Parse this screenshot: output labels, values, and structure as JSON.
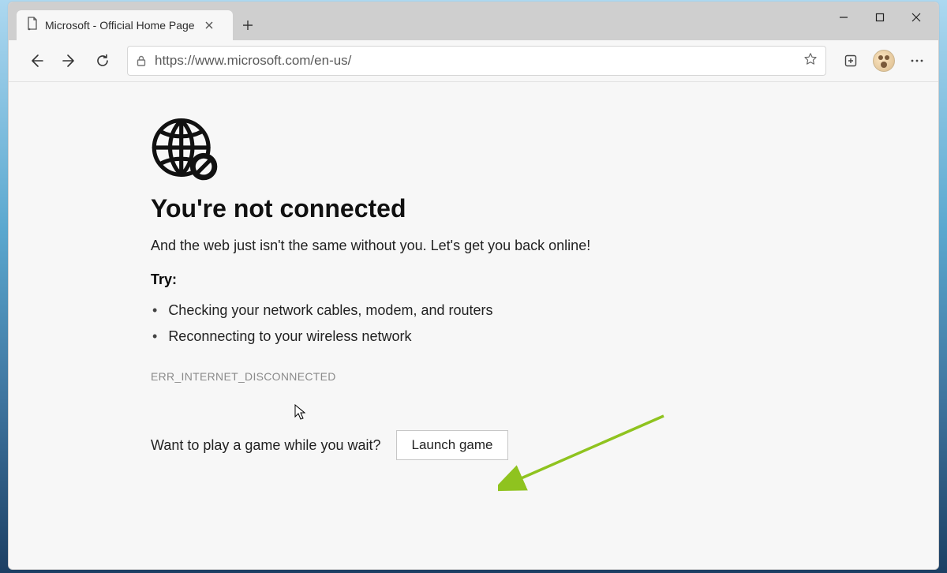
{
  "tab": {
    "title": "Microsoft - Official Home Page"
  },
  "addressbar": {
    "scheme_host_path": "https://www.microsoft.com/en-us/",
    "host": "www.microsoft.com"
  },
  "error": {
    "title": "You're not connected",
    "subtitle": "And the web just isn't the same without you. Let's get you back online!",
    "try_label": "Try:",
    "tips": [
      "Checking your network cables, modem, and routers",
      "Reconnecting to your wireless network"
    ],
    "code": "ERR_INTERNET_DISCONNECTED",
    "play_prompt": "Want to play a game while you wait?",
    "launch_button": "Launch game"
  },
  "annotation": {
    "arrow_color": "#8fc31f"
  }
}
